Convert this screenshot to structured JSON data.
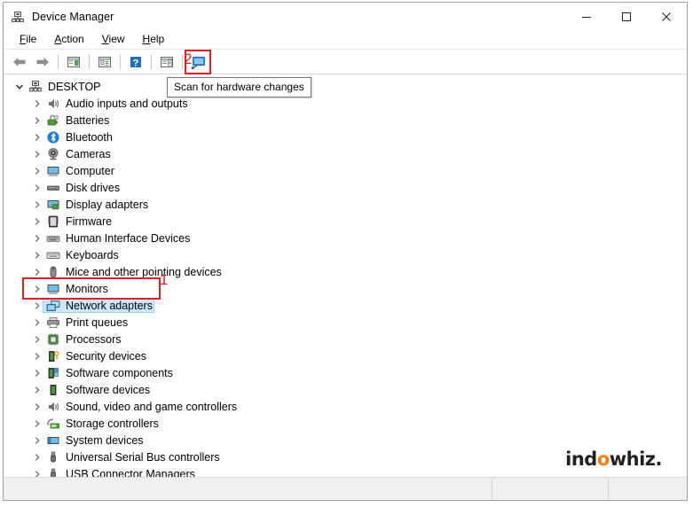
{
  "window": {
    "title": "Device Manager",
    "icon": "device-manager-icon",
    "controls": {
      "minimize": "─",
      "maximize": "□",
      "close": "✕"
    }
  },
  "menubar": {
    "items": [
      {
        "label": "File",
        "accesskey": "F"
      },
      {
        "label": "Action",
        "accesskey": "A"
      },
      {
        "label": "View",
        "accesskey": "V"
      },
      {
        "label": "Help",
        "accesskey": "H"
      }
    ]
  },
  "toolbar": {
    "buttons": [
      {
        "name": "back-button",
        "icon": "back-arrow-icon"
      },
      {
        "name": "forward-button",
        "icon": "forward-arrow-icon"
      },
      {
        "name": "show-hide-console-tree-button",
        "icon": "console-tree-icon"
      },
      {
        "name": "properties-button",
        "icon": "properties-icon"
      },
      {
        "name": "help-button",
        "icon": "question-mark-icon"
      },
      {
        "name": "update-driver-button",
        "icon": "update-driver-icon"
      },
      {
        "name": "scan-for-hardware-changes-button",
        "icon": "scan-hardware-icon"
      }
    ]
  },
  "tooltip": {
    "text": "Scan for hardware changes"
  },
  "annotations": {
    "marker_one": "1",
    "marker_two": "2",
    "color": "#e02020"
  },
  "tree": {
    "root": {
      "label": "DESKTOP",
      "icon": "computer-root-icon",
      "expanded": true
    },
    "items": [
      {
        "label": "Audio inputs and outputs",
        "icon": "speaker-icon"
      },
      {
        "label": "Batteries",
        "icon": "battery-icon"
      },
      {
        "label": "Bluetooth",
        "icon": "bluetooth-icon"
      },
      {
        "label": "Cameras",
        "icon": "camera-icon"
      },
      {
        "label": "Computer",
        "icon": "monitor-icon"
      },
      {
        "label": "Disk drives",
        "icon": "disk-drive-icon"
      },
      {
        "label": "Display adapters",
        "icon": "display-adapter-icon"
      },
      {
        "label": "Firmware",
        "icon": "firmware-icon"
      },
      {
        "label": "Human Interface Devices",
        "icon": "hid-icon"
      },
      {
        "label": "Keyboards",
        "icon": "keyboard-icon"
      },
      {
        "label": "Mice and other pointing devices",
        "icon": "mouse-icon"
      },
      {
        "label": "Monitors",
        "icon": "monitor-icon"
      },
      {
        "label": "Network adapters",
        "icon": "network-adapter-icon",
        "selected": true
      },
      {
        "label": "Print queues",
        "icon": "printer-icon"
      },
      {
        "label": "Processors",
        "icon": "processor-icon"
      },
      {
        "label": "Security devices",
        "icon": "security-device-icon"
      },
      {
        "label": "Software components",
        "icon": "software-component-icon"
      },
      {
        "label": "Software devices",
        "icon": "software-device-icon"
      },
      {
        "label": "Sound, video and game controllers",
        "icon": "sound-controller-icon"
      },
      {
        "label": "Storage controllers",
        "icon": "storage-controller-icon"
      },
      {
        "label": "System devices",
        "icon": "system-device-icon"
      },
      {
        "label": "Universal Serial Bus controllers",
        "icon": "usb-controller-icon"
      },
      {
        "label": "USB Connector Managers",
        "icon": "usb-connector-icon"
      }
    ]
  },
  "watermark": {
    "text_before": "ind",
    "text_accent": "o",
    "text_after": "whiz.",
    "accent_color": "#f07f13"
  },
  "statusbar": {
    "pane1": "",
    "pane2": "",
    "pane3": ""
  }
}
